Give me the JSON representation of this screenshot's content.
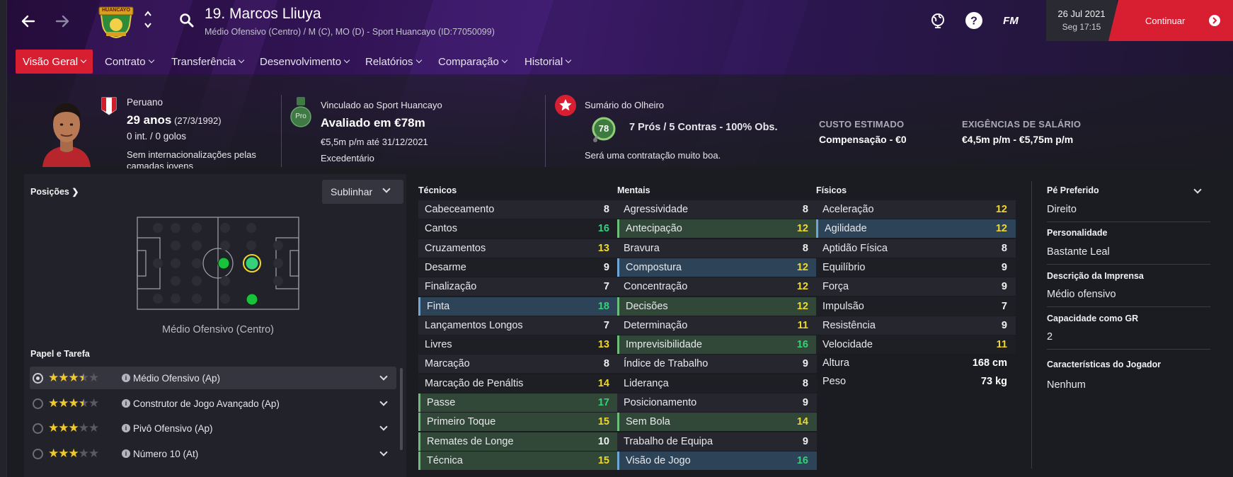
{
  "header": {
    "player_name": "19. Marcos Lliuya",
    "player_subtitle": "Médio Ofensivo (Centro) / M (C), MO (D) - Sport Huancayo (ID:77050099)",
    "club_badge_text": "HUANCAYO",
    "icons": [
      "back-arrow-icon",
      "forward-arrow-icon",
      "club-badge",
      "chevron-up-icon",
      "chevron-down-icon",
      "search-icon",
      "globe-icon",
      "help-icon",
      "fm-logo"
    ],
    "fm_label": "FM",
    "date": "26 Jul 2021",
    "time": "Seg 17:15",
    "continue_label": "Continuar"
  },
  "tabs": [
    {
      "label": "Visão Geral",
      "active": true
    },
    {
      "label": "Contrato"
    },
    {
      "label": "Transferência"
    },
    {
      "label": "Desenvolvimento"
    },
    {
      "label": "Relatórios"
    },
    {
      "label": "Comparação"
    },
    {
      "label": "Historial"
    }
  ],
  "info": {
    "nationality": "Peruano",
    "age": "29 anos",
    "birth": "(27/3/1992)",
    "caps": "0 int. / 0 golos",
    "intl_line1": "Sem internacionalizações pelas",
    "intl_line2": "camadas jovens",
    "contract_title": "Vinculado ao Sport Huancayo",
    "valuation": "Avaliado em €78m",
    "wage": "€5,5m p/m até 31/12/2021",
    "status": "Excedentário",
    "pro_badge": "Pro",
    "scout_title": "Sumário do Olheiro",
    "scout_rating": "78",
    "scout_summary": "7 Prós / 5 Contras - 100% Obs.",
    "scout_verdict": "Será uma contratação muito boa.",
    "cost_label": "CUSTO ESTIMADO",
    "cost_value": "Compensação - €0",
    "salary_label": "EXIGÊNCIAS DE SALÁRIO",
    "salary_value": "€4,5m p/m - €5,75m p/m"
  },
  "positions": {
    "header": "Posições",
    "highlight_button": "Sublinhar",
    "position_label": "Médio Ofensivo (Centro)"
  },
  "roles": {
    "header": "Papel e Tarefa",
    "items": [
      {
        "name": "Médio Ofensivo (Ap)",
        "stars": 3.5,
        "selected": true
      },
      {
        "name": "Construtor de Jogo Avançado (Ap)",
        "stars": 3.5,
        "selected": false
      },
      {
        "name": "Pivô Ofensivo (Ap)",
        "stars": 3,
        "selected": false
      },
      {
        "name": "Número 10 (At)",
        "stars": 3,
        "selected": false
      }
    ]
  },
  "attributes": {
    "technical_header": "Técnicos",
    "mental_header": "Mentais",
    "physical_header": "Físicos",
    "technical": [
      {
        "n": "Cabeceamento",
        "v": "8"
      },
      {
        "n": "Cantos",
        "v": "16"
      },
      {
        "n": "Cruzamentos",
        "v": "13"
      },
      {
        "n": "Desarme",
        "v": "9"
      },
      {
        "n": "Finalização",
        "v": "7"
      },
      {
        "n": "Finta",
        "v": "18",
        "hl": "blue"
      },
      {
        "n": "Lançamentos Longos",
        "v": "7"
      },
      {
        "n": "Livres",
        "v": "13"
      },
      {
        "n": "Marcação",
        "v": "8"
      },
      {
        "n": "Marcação de Penáltis",
        "v": "14"
      },
      {
        "n": "Passe",
        "v": "17",
        "hl": "green"
      },
      {
        "n": "Primeiro Toque",
        "v": "15",
        "hl": "green"
      },
      {
        "n": "Remates de Longe",
        "v": "10",
        "hl": "green"
      },
      {
        "n": "Técnica",
        "v": "15",
        "hl": "green"
      }
    ],
    "mental": [
      {
        "n": "Agressividade",
        "v": "8"
      },
      {
        "n": "Antecipação",
        "v": "12",
        "hl": "green"
      },
      {
        "n": "Bravura",
        "v": "8"
      },
      {
        "n": "Compostura",
        "v": "12",
        "hl": "blue"
      },
      {
        "n": "Concentração",
        "v": "12"
      },
      {
        "n": "Decisões",
        "v": "12",
        "hl": "green"
      },
      {
        "n": "Determinação",
        "v": "11"
      },
      {
        "n": "Imprevisibilidade",
        "v": "16",
        "hl": "green"
      },
      {
        "n": "Índice de Trabalho",
        "v": "9"
      },
      {
        "n": "Liderança",
        "v": "8"
      },
      {
        "n": "Posicionamento",
        "v": "9"
      },
      {
        "n": "Sem Bola",
        "v": "14",
        "hl": "green"
      },
      {
        "n": "Trabalho de Equipa",
        "v": "9"
      },
      {
        "n": "Visão de Jogo",
        "v": "16",
        "hl": "blue"
      }
    ],
    "physical": [
      {
        "n": "Aceleração",
        "v": "12"
      },
      {
        "n": "Agilidade",
        "v": "12",
        "hl": "blue"
      },
      {
        "n": "Aptidão Física",
        "v": "8"
      },
      {
        "n": "Equilíbrio",
        "v": "9"
      },
      {
        "n": "Força",
        "v": "9"
      },
      {
        "n": "Impulsão",
        "v": "7"
      },
      {
        "n": "Resistência",
        "v": "9"
      },
      {
        "n": "Velocidade",
        "v": "11"
      }
    ],
    "height_label": "Altura",
    "height_value": "168 cm",
    "weight_label": "Peso",
    "weight_value": "73 kg"
  },
  "details": {
    "foot_label": "Pé Preferido",
    "foot_value": "Direito",
    "personality_label": "Personalidade",
    "personality_value": "Bastante Leal",
    "media_label": "Descrição da Imprensa",
    "media_value": "Médio ofensivo",
    "gk_label": "Capacidade como GR",
    "gk_value": "2",
    "traits_label": "Características do Jogador",
    "traits_value": "Nenhum"
  },
  "colors": {
    "accent": "#d81f32",
    "highlight_green": "#314838",
    "highlight_blue": "#2d4358",
    "rating_yellow": "#f0d82a",
    "rating_green": "#33d27a"
  }
}
